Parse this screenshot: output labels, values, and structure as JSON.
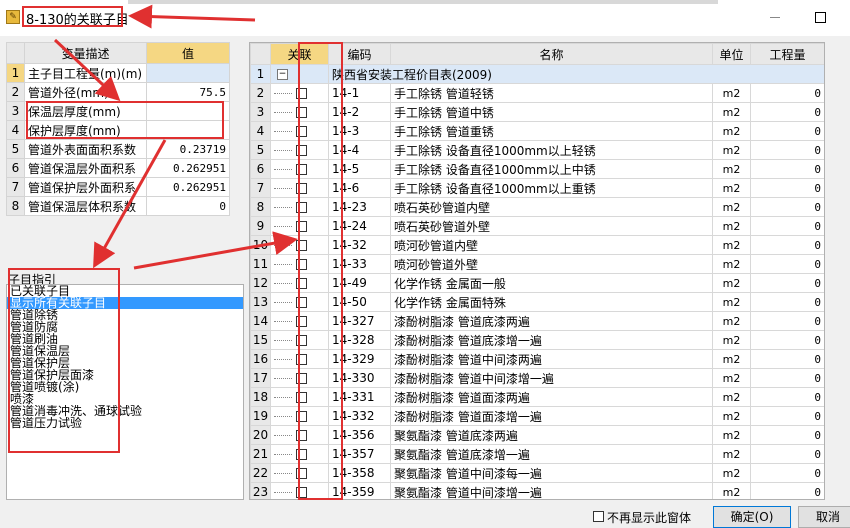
{
  "window": {
    "title": "8-130的关联子目"
  },
  "variables": {
    "headers": {
      "desc": "变量描述",
      "value": "值"
    },
    "rows": [
      {
        "n": "1",
        "desc": "主子目工程量(m)(m)",
        "value": ""
      },
      {
        "n": "2",
        "desc": "管道外径(mm)",
        "value": "75.5"
      },
      {
        "n": "3",
        "desc": "保温层厚度(mm)",
        "value": ""
      },
      {
        "n": "4",
        "desc": "保护层厚度(mm)",
        "value": ""
      },
      {
        "n": "5",
        "desc": "管道外表面面积系数",
        "value": "0.23719"
      },
      {
        "n": "6",
        "desc": "管道保温层外面积系",
        "value": "0.262951"
      },
      {
        "n": "7",
        "desc": "管道保护层外面积系",
        "value": "0.262951"
      },
      {
        "n": "8",
        "desc": "管道保温层体积系数",
        "value": "0"
      }
    ]
  },
  "guide": {
    "title": "子目指引",
    "items": [
      "已关联子目",
      "显示所有关联子目",
      "管道除锈",
      "管道防腐",
      "管道刷油",
      "管道保温层",
      "管道保护层",
      "管道保护层面漆",
      "管道喷镀(涂)",
      "喷漆",
      "管道消毒冲洗、通球试验",
      "管道压力试验"
    ],
    "selected_index": 1
  },
  "grid": {
    "headers": {
      "rel": "关联",
      "code": "编码",
      "name": "名称",
      "unit": "单位",
      "qty": "工程量"
    },
    "group_row": {
      "n": "1",
      "toggle": "−",
      "name": "陕西省安装工程价目表(2009)"
    },
    "rows": [
      {
        "n": "2",
        "code": "14-1",
        "name": "手工除锈 管道轻锈",
        "unit": "m2",
        "qty": "0"
      },
      {
        "n": "3",
        "code": "14-2",
        "name": "手工除锈 管道中锈",
        "unit": "m2",
        "qty": "0"
      },
      {
        "n": "4",
        "code": "14-3",
        "name": "手工除锈 管道重锈",
        "unit": "m2",
        "qty": "0"
      },
      {
        "n": "5",
        "code": "14-4",
        "name": "手工除锈 设备直径1000mm以上轻锈",
        "unit": "m2",
        "qty": "0"
      },
      {
        "n": "6",
        "code": "14-5",
        "name": "手工除锈 设备直径1000mm以上中锈",
        "unit": "m2",
        "qty": "0"
      },
      {
        "n": "7",
        "code": "14-6",
        "name": "手工除锈 设备直径1000mm以上重锈",
        "unit": "m2",
        "qty": "0"
      },
      {
        "n": "8",
        "code": "14-23",
        "name": "喷石英砂管道内壁",
        "unit": "m2",
        "qty": "0"
      },
      {
        "n": "9",
        "code": "14-24",
        "name": "喷石英砂管道外壁",
        "unit": "m2",
        "qty": "0"
      },
      {
        "n": "10",
        "code": "14-32",
        "name": "喷河砂管道内壁",
        "unit": "m2",
        "qty": "0"
      },
      {
        "n": "11",
        "code": "14-33",
        "name": "喷河砂管道外壁",
        "unit": "m2",
        "qty": "0"
      },
      {
        "n": "12",
        "code": "14-49",
        "name": "化学作锈 金属面一般",
        "unit": "m2",
        "qty": "0"
      },
      {
        "n": "13",
        "code": "14-50",
        "name": "化学作锈 金属面特殊",
        "unit": "m2",
        "qty": "0"
      },
      {
        "n": "14",
        "code": "14-327",
        "name": "漆酚树脂漆 管道底漆两遍",
        "unit": "m2",
        "qty": "0"
      },
      {
        "n": "15",
        "code": "14-328",
        "name": "漆酚树脂漆 管道底漆增一遍",
        "unit": "m2",
        "qty": "0"
      },
      {
        "n": "16",
        "code": "14-329",
        "name": "漆酚树脂漆 管道中间漆两遍",
        "unit": "m2",
        "qty": "0"
      },
      {
        "n": "17",
        "code": "14-330",
        "name": "漆酚树脂漆 管道中间漆增一遍",
        "unit": "m2",
        "qty": "0"
      },
      {
        "n": "18",
        "code": "14-331",
        "name": "漆酚树脂漆 管道面漆两遍",
        "unit": "m2",
        "qty": "0"
      },
      {
        "n": "19",
        "code": "14-332",
        "name": "漆酚树脂漆 管道面漆增一遍",
        "unit": "m2",
        "qty": "0"
      },
      {
        "n": "20",
        "code": "14-356",
        "name": "聚氨酯漆 管道底漆两遍",
        "unit": "m2",
        "qty": "0"
      },
      {
        "n": "21",
        "code": "14-357",
        "name": "聚氨酯漆 管道底漆增一遍",
        "unit": "m2",
        "qty": "0"
      },
      {
        "n": "22",
        "code": "14-358",
        "name": "聚氨酯漆 管道中间漆每一遍",
        "unit": "m2",
        "qty": "0"
      },
      {
        "n": "23",
        "code": "14-359",
        "name": "聚氨酯漆 管道中间漆增一遍",
        "unit": "m2",
        "qty": "0"
      }
    ]
  },
  "footer": {
    "dont_show": "不再显示此窗体",
    "ok": "确定(O)",
    "cancel": "取消"
  },
  "colors": {
    "annotation": "#e03030",
    "header_highlight": "#f5d783",
    "selection": "#3399ff"
  }
}
